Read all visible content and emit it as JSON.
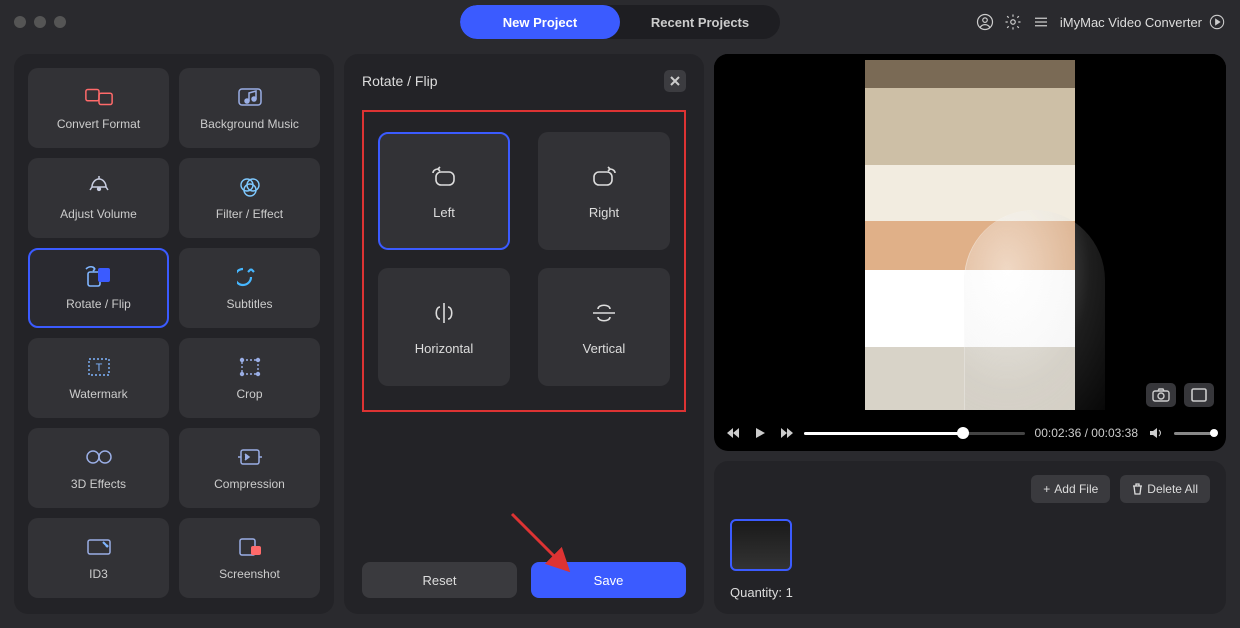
{
  "header": {
    "tab_new": "New Project",
    "tab_recent": "Recent Projects",
    "app_name": "iMyMac Video Converter"
  },
  "sidebar": {
    "tools": [
      {
        "label": "Convert Format",
        "icon": "convert-icon"
      },
      {
        "label": "Background Music",
        "icon": "music-icon"
      },
      {
        "label": "Adjust Volume",
        "icon": "volume-icon"
      },
      {
        "label": "Filter / Effect",
        "icon": "filter-icon"
      },
      {
        "label": "Rotate / Flip",
        "icon": "rotate-icon",
        "selected": true
      },
      {
        "label": "Subtitles",
        "icon": "subtitles-icon"
      },
      {
        "label": "Watermark",
        "icon": "watermark-icon"
      },
      {
        "label": "Crop",
        "icon": "crop-icon"
      },
      {
        "label": "3D Effects",
        "icon": "3d-icon"
      },
      {
        "label": "Compression",
        "icon": "compress-icon"
      },
      {
        "label": "ID3",
        "icon": "id3-icon"
      },
      {
        "label": "Screenshot",
        "icon": "screenshot-icon"
      }
    ]
  },
  "center": {
    "title": "Rotate / Flip",
    "options": [
      {
        "label": "Left",
        "icon": "rotate-left-icon",
        "selected": true
      },
      {
        "label": "Right",
        "icon": "rotate-right-icon"
      },
      {
        "label": "Horizontal",
        "icon": "flip-h-icon"
      },
      {
        "label": "Vertical",
        "icon": "flip-v-icon"
      }
    ],
    "reset_label": "Reset",
    "save_label": "Save"
  },
  "preview": {
    "current_time": "00:02:36",
    "total_time": "00:03:38",
    "sep": " / "
  },
  "queue": {
    "add_label": "Add File",
    "delete_label": "Delete All",
    "quantity_label": "Quantity:",
    "quantity_value": "1"
  }
}
